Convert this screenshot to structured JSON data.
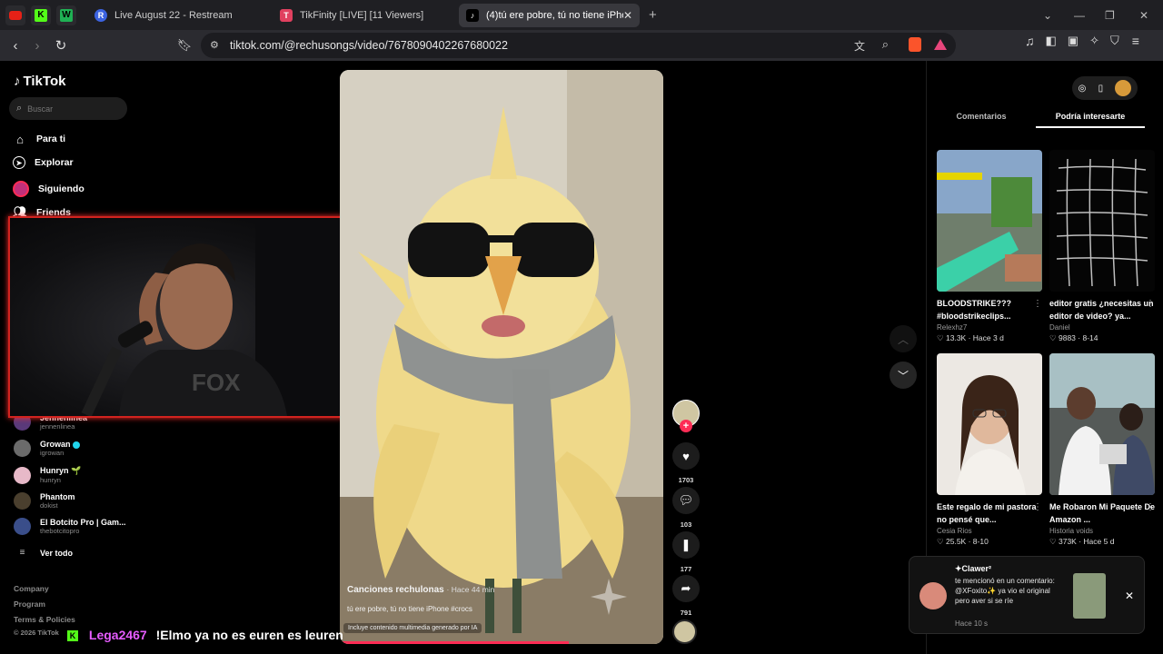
{
  "browser": {
    "tabs": [
      {
        "label": "Live August 22 - Restream"
      },
      {
        "label": "TikFinity [LIVE] [11 Viewers]"
      },
      {
        "label": "(4)tú ere pobre, tú no tiene iPhone"
      }
    ],
    "url": "tiktok.com/@rechusongs/video/7678090402267680022"
  },
  "sidebar": {
    "logo": "TikTok",
    "search_placeholder": "Buscar",
    "menu": [
      {
        "label": "Para ti"
      },
      {
        "label": "Explorar"
      },
      {
        "label": "Siguiendo"
      },
      {
        "label": "Friends"
      }
    ],
    "following": [
      {
        "name": "Jennenlinea",
        "handle": "jennenlinea"
      },
      {
        "name": "Growan",
        "handle": "igrowan"
      },
      {
        "name": "Hunryn 🌱",
        "handle": "hunryn"
      },
      {
        "name": "Phantom",
        "handle": "dokist"
      },
      {
        "name": "El Botcito Pro | Gam...",
        "handle": "thebotcitopro"
      }
    ],
    "see_all": "Ver todo",
    "footer": [
      "Company",
      "Program",
      "Terms & Policies",
      "© 2026 TikTok"
    ]
  },
  "video": {
    "author": "Canciones rechulonas",
    "time": "Hace 44 min",
    "caption": "tú ere pobre, tú no tiene iPhone #crocs",
    "ai_label": "Incluye contenido multimedia generado por IA",
    "likes": "1703",
    "comments": "103",
    "saves": "177",
    "shares": "791"
  },
  "right_panel": {
    "tabs": [
      "Comentarios",
      "Podría interesarte"
    ],
    "cards": [
      {
        "title": "BLOODSTRIKE??? #bloodstrikeclips...",
        "author": "Relexhz7",
        "likes": "13.3K",
        "date": "Hace 3 d"
      },
      {
        "title": "editor gratis ¿necesitas un editor de video? ya...",
        "author": "Daniel",
        "likes": "9883",
        "date": "8-14"
      },
      {
        "title": "Este regalo de mi pastora no pensé que...",
        "author": "Cesia Rios",
        "likes": "25.5K",
        "date": "8-10"
      },
      {
        "title": "Me Robaron Mi Paquete De Amazon ...",
        "author": "Historia voids",
        "likes": "373K",
        "date": "Hace 5 d"
      }
    ]
  },
  "notification": {
    "user": "✦Clawer²",
    "message": "te mencionó en un comentario: @XFoxito✨ ya vio el original pero aver si se ríe",
    "time": "Hace 10 s"
  },
  "chat": {
    "user": "Lega2467",
    "message": "!Elmo ya no es euren es leuren"
  },
  "colors": {
    "accent": "#fe2c55",
    "cam_border": "#d2231f",
    "chat_user": "#e65cff"
  }
}
